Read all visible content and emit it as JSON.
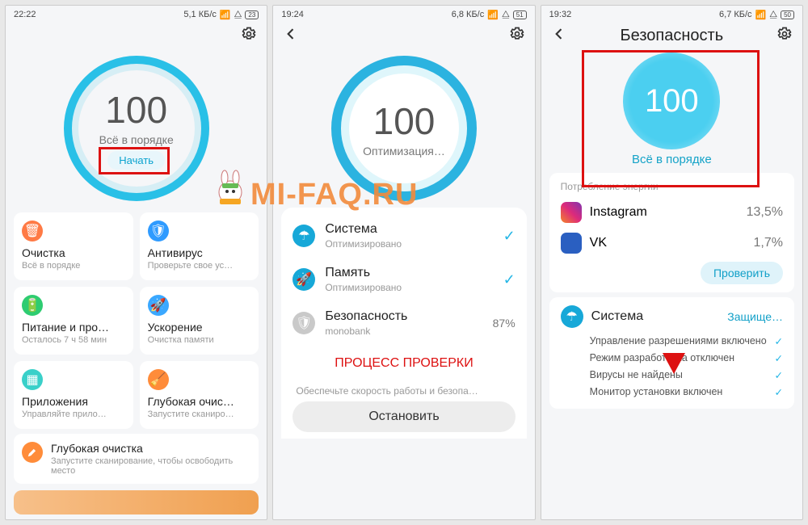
{
  "watermark": "MI-FAQ.RU",
  "panel1": {
    "status": {
      "time": "22:22",
      "net": "5,1 КБ/с",
      "batt": "23"
    },
    "score": "100",
    "subtitle": "Всё в порядке",
    "start": "Начать",
    "cards": [
      {
        "title": "Очистка",
        "sub": "Всё в порядке",
        "color": "#ff7a45",
        "icon": "trash"
      },
      {
        "title": "Антивирус",
        "sub": "Проверьте свое ус…",
        "color": "#2f9bff",
        "icon": "shield"
      },
      {
        "title": "Питание и про…",
        "sub": "Осталось 7 ч 58 мин",
        "color": "#2ecc71",
        "icon": "battery"
      },
      {
        "title": "Ускорение",
        "sub": "Очистка памяти",
        "color": "#3aa8ff",
        "icon": "rocket"
      },
      {
        "title": "Приложения",
        "sub": "Управляйте прило…",
        "color": "#3ad0c9",
        "icon": "apps"
      },
      {
        "title": "Глубокая очис…",
        "sub": "Запустите сканиро…",
        "color": "#ff8c3a",
        "icon": "deep"
      }
    ],
    "deep": {
      "title": "Глубокая очистка",
      "sub": "Запустите сканирование, чтобы освободить место"
    }
  },
  "panel2": {
    "status": {
      "time": "19:24",
      "net": "6,8 КБ/с",
      "batt": "51"
    },
    "score": "100",
    "subtitle": "Оптимизация…",
    "rows": [
      {
        "title": "Система",
        "sub": "Оптимизировано",
        "icon": "umbrella",
        "color": "#17a8d8",
        "right": "check"
      },
      {
        "title": "Память",
        "sub": "Оптимизировано",
        "icon": "rocket",
        "color": "#17a8d8",
        "right": "check"
      },
      {
        "title": "Безопасность",
        "sub": "monobank",
        "icon": "shield",
        "color": "#c9c9c9",
        "right": "87%"
      }
    ],
    "process": "ПРОЦЕСС ПРОВЕРКИ",
    "hint": "Обеспечьте скорость работы и безопа…",
    "stop": "Остановить"
  },
  "panel3": {
    "status": {
      "time": "19:32",
      "net": "6,7 КБ/с",
      "batt": "50"
    },
    "title": "Безопасность",
    "score": "100",
    "statusline": "Всё в порядке",
    "energy_head": "Потребление энергии",
    "apps": [
      {
        "name": "Instagram",
        "pct": "13,5%",
        "color": "linear-gradient(45deg,#f58529,#dd2a7b,#8134af)"
      },
      {
        "name": "VK",
        "pct": "1,7%",
        "color": "#2a5fc1"
      }
    ],
    "check": "Проверить",
    "system": {
      "label": "Система",
      "badge": "Защище…"
    },
    "checks": [
      "Управление разрешениями включено",
      "Режим разработчика отключен",
      "Вирусы не найдены",
      "Монитор установки включен"
    ]
  }
}
